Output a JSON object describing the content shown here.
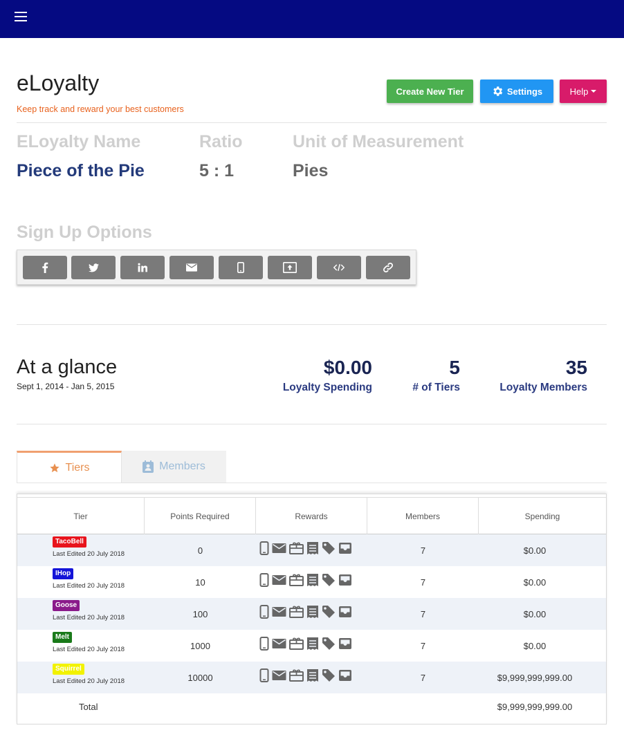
{
  "app": {
    "title": "eLoyalty",
    "subtitle": "Keep track and reward your best customers"
  },
  "header_buttons": {
    "create": "Create New Tier",
    "settings": "Settings",
    "help": "Help"
  },
  "program": {
    "name_label": "ELoyalty Name",
    "ratio_label": "Ratio",
    "unit_label": "Unit of Measurement",
    "name_value": "Piece of the Pie",
    "ratio_value": "5 : 1",
    "unit_value": "Pies"
  },
  "signup": {
    "title": "Sign Up Options",
    "options": [
      "facebook-icon",
      "twitter-icon",
      "linkedin-icon",
      "email-icon",
      "mobile-icon",
      "tablet-upload-icon",
      "code-icon",
      "link-icon"
    ]
  },
  "glance": {
    "title": "At a glance",
    "date_range": "Sept 1, 2014 - Jan 5, 2015",
    "spending_value": "$0.00",
    "spending_label": "Loyalty Spending",
    "tiers_value": "5",
    "tiers_label": "# of Tiers",
    "members_value": "35",
    "members_label": "Loyalty Members"
  },
  "tabs": {
    "tiers": "Tiers",
    "members": "Members"
  },
  "table": {
    "headers": [
      "Tier",
      "Points Required",
      "Rewards",
      "Members",
      "Spending"
    ],
    "rows": [
      {
        "name": "TacoBell",
        "color": "#e8141c",
        "edited": "Last Edited 20 July 2018",
        "points": "0",
        "members": "7",
        "spending": "$0.00"
      },
      {
        "name": "IHop",
        "color": "#1414d8",
        "edited": "Last Edited 20 July 2018",
        "points": "10",
        "members": "7",
        "spending": "$0.00"
      },
      {
        "name": "Goose",
        "color": "#8a1a8a",
        "edited": "Last Edited 20 July 2018",
        "points": "100",
        "members": "7",
        "spending": "$0.00"
      },
      {
        "name": "Melt",
        "color": "#1a7a1a",
        "edited": "Last Edited 20 July 2018",
        "points": "1000",
        "members": "7",
        "spending": "$0.00"
      },
      {
        "name": "Squirrel",
        "color": "#f2f200",
        "edited": "Last Edited 20 July 2018",
        "points": "10000",
        "members": "7",
        "spending": "$9,999,999,999.00"
      }
    ],
    "reward_icons": [
      "mobile-icon",
      "email-icon",
      "gift-card-icon",
      "receipt-icon",
      "tag-icon",
      "inbox-icon"
    ],
    "total_label": "Total",
    "total_value": "$9,999,999,999.00"
  },
  "colors": {
    "topbar": "#050a82",
    "create_button": "#4cb050",
    "settings_button": "#2196f3",
    "help_button": "#d81b6a",
    "accent_orange": "#e8621e",
    "dark_blue_text": "#1a2553"
  }
}
